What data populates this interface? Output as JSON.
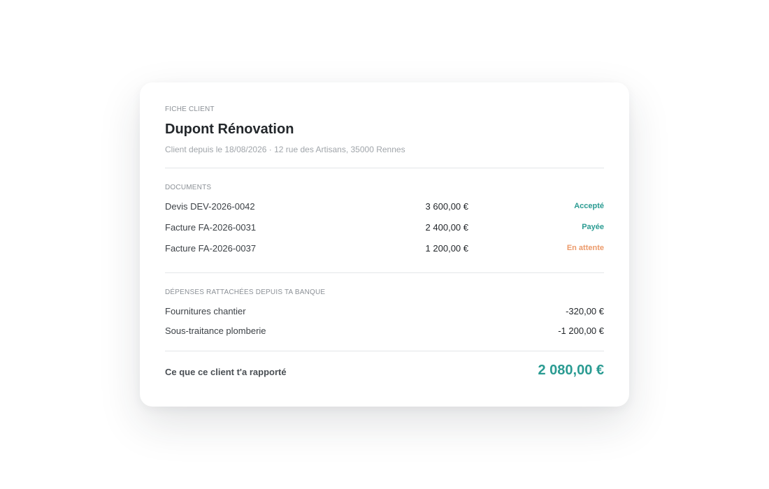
{
  "colors": {
    "accent": "#2a9b92",
    "status_accepted": "#2a9b92",
    "status_paid": "#2a9b92",
    "status_pending": "#ec9a6a"
  },
  "card": {
    "eyebrow": "FICHE CLIENT",
    "client_name": "Dupont Rénovation",
    "client_subtitle": "Client depuis le 18/08/2026 · 12 rue des Artisans, 35000 Rennes"
  },
  "documents": {
    "heading": "DOCUMENTS",
    "items": [
      {
        "label": "Devis DEV-2026-0042",
        "amount": "3 600,00 €",
        "status": "Accepté",
        "status_key": "status_accepted"
      },
      {
        "label": "Facture FA-2026-0031",
        "amount": "2 400,00 €",
        "status": "Payée",
        "status_key": "status_paid"
      },
      {
        "label": "Facture FA-2026-0037",
        "amount": "1 200,00 €",
        "status": "En attente",
        "status_key": "status_pending"
      }
    ]
  },
  "expenses": {
    "heading": "DÉPENSES RATTACHÉES DEPUIS TA BANQUE",
    "items": [
      {
        "label": "Fournitures chantier",
        "amount": "-320,00 €"
      },
      {
        "label": "Sous-traitance plomberie",
        "amount": "-1 200,00 €"
      }
    ]
  },
  "total": {
    "label": "Ce que ce client t'a rapporté",
    "value": "2 080,00 €"
  }
}
